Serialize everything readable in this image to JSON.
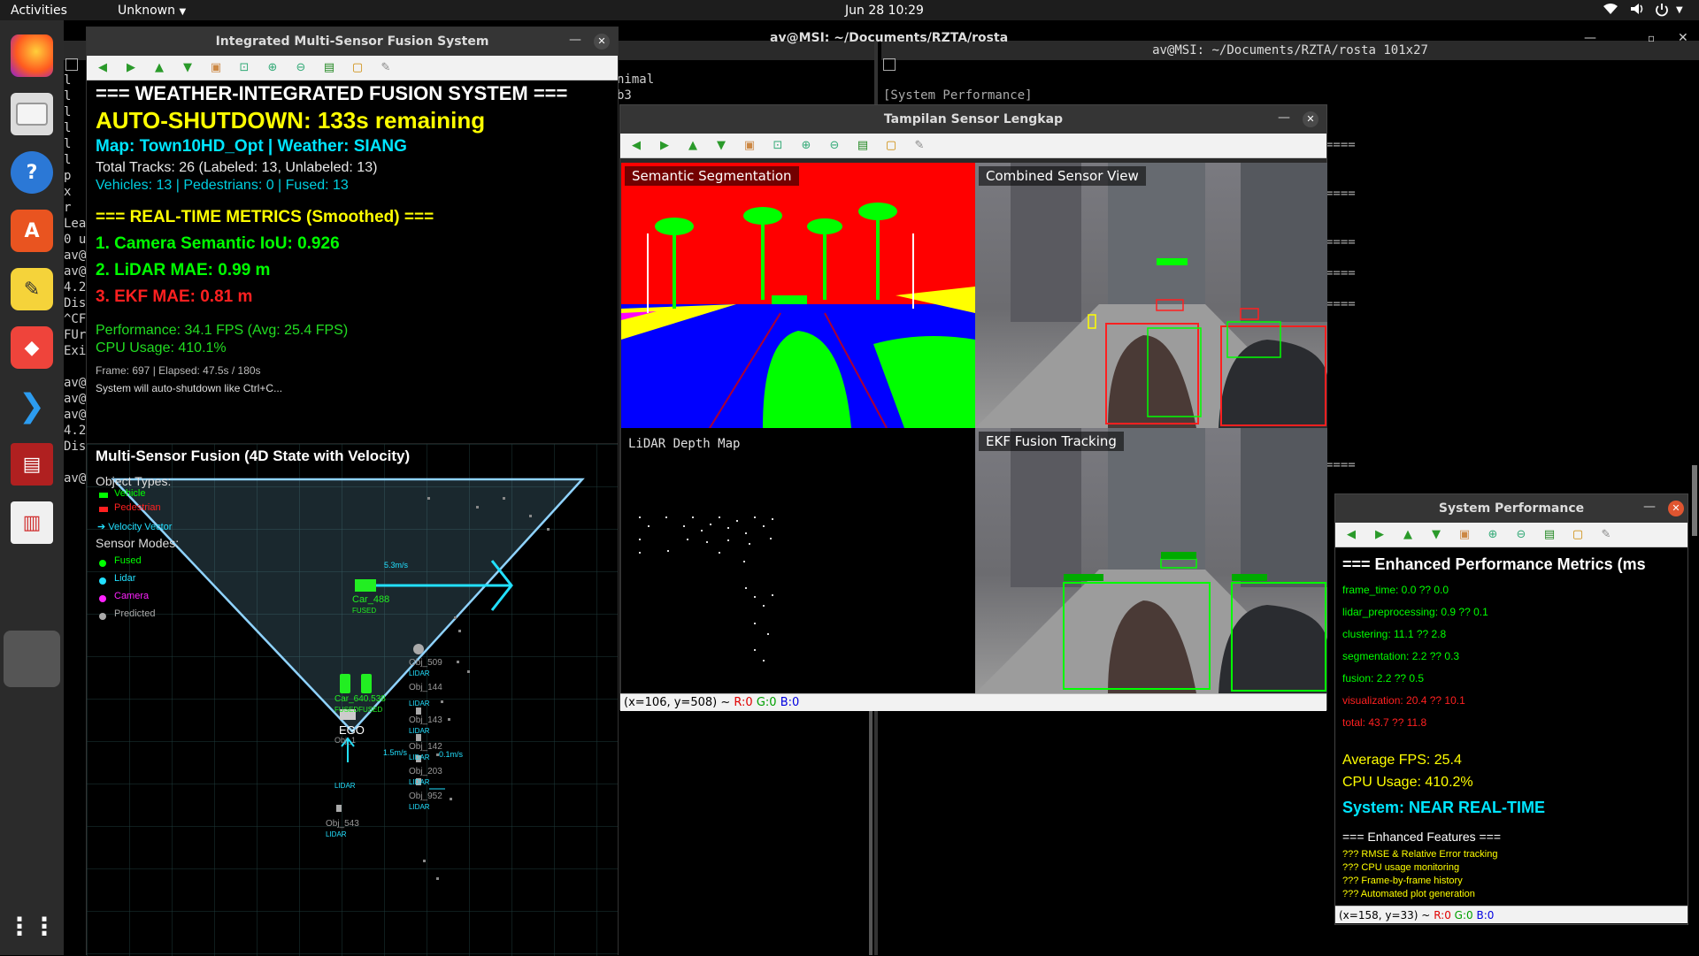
{
  "topbar": {
    "activities": "Activities",
    "app_menu": "Unknown",
    "clock": "Jun 28  10:29"
  },
  "dock": {
    "icons": [
      "firefox-icon",
      "files-icon",
      "help-icon",
      "app-center-icon",
      "text-editor-icon",
      "anydesk-icon",
      "vscode-icon",
      "system-monitor-icon",
      "document-viewer-icon",
      "show-apps-icon"
    ]
  },
  "terminal_left": {
    "title": "av@MSI: ~/Documents/RZTA/rosta",
    "lines": [
      "l",
      "l",
      "l",
      "l",
      "l",
      "l",
      "p",
      "x",
      "r",
      "Lea",
      "0 u",
      "av@",
      "av@",
      "4.2",
      "Dis",
      "^CF",
      "FUr",
      "Exi",
      "",
      "av@",
      "av@",
      "av@",
      "4.2",
      "Dis",
      "",
      "av@"
    ],
    "snippet1": "nimal",
    "snippet2": "b3"
  },
  "terminal_right": {
    "title": "av@MSI: ~/Documents/RZTA/rosta 101x27",
    "line1": "[System Performance]",
    "dashes": [
      "====",
      "====",
      "====",
      "====",
      "====",
      "===="
    ]
  },
  "fusion_window": {
    "title": "Integrated Multi-Sensor Fusion System",
    "header": "=== WEATHER-INTEGRATED FUSION SYSTEM ===",
    "auto_shutdown": "AUTO-SHUTDOWN: 133s remaining",
    "map_weather": "Map: Town10HD_Opt | Weather: SIANG",
    "total_tracks": "Total Tracks: 26 (Labeled: 13, Unlabeled: 13)",
    "counts": "Vehicles: 13 | Pedestrians: 0 | Fused: 13",
    "metrics_header": "=== REAL-TIME METRICS (Smoothed) ===",
    "metric1": "1. Camera Semantic IoU: 0.926",
    "metric2": "2. LiDAR MAE: 0.99 m",
    "metric3": "3. EKF MAE: 0.81 m",
    "performance": "Performance: 34.1 FPS (Avg: 25.4 FPS)",
    "cpu": "CPU Usage: 410.1%",
    "frame": "Frame: 697 | Elapsed: 47.5s / 180s",
    "shutdown_note": "System will auto-shutdown like Ctrl+C...",
    "bev_title": "Multi-Sensor Fusion (4D State with Velocity)",
    "object_types": "Object Types:",
    "legend_vehicle": "Vehicle",
    "legend_pedestrian": "Pedestrian",
    "legend_velocity": "Velocity Vector",
    "sensor_modes": "Sensor Modes:",
    "mode_fused": "Fused",
    "mode_lidar": "Lidar",
    "mode_camera": "Camera",
    "mode_predicted": "Predicted",
    "car_label": "Car_488",
    "car_tag": "FUSED",
    "car_speed": "5.3m/s",
    "ego": "EGO",
    "ego_speed": "1.5m/s",
    "near_label": "Car_640.538",
    "near_tag": "FUSEDFUSED",
    "objects": [
      {
        "name": "Obj_509",
        "tag": "LIDAR"
      },
      {
        "name": "Obj_144",
        "tag": "LIDAR"
      },
      {
        "name": "Obj_143",
        "tag": "LIDAR"
      },
      {
        "name": "Obj_142",
        "tag": "LIDAR"
      },
      {
        "name": "Obj_203",
        "tag": "LIDAR"
      },
      {
        "name": "Obj_952",
        "tag": "LIDAR"
      },
      {
        "name": "Obj_543",
        "tag": "LIDAR"
      },
      {
        "name": "Obj_1",
        "tag": "LIDAR"
      }
    ],
    "obj142_speed": "0.1m/s"
  },
  "sensor_window": {
    "title": "Tampilan Sensor Lengkap",
    "panel1": "Semantic Segmentation",
    "panel2": "Combined Sensor View",
    "panel3": "LiDAR Depth Map",
    "panel4": "EKF Fusion Tracking",
    "status": "(x=106, y=508) ~",
    "r": "R:0",
    "g": "G:0",
    "b": "B:0"
  },
  "perf_window": {
    "title": "System Performance",
    "header": "=== Enhanced Performance Metrics (ms",
    "frame_time": "frame_time: 0.0 ?? 0.0",
    "lidar_pre": "lidar_preprocessing: 0.9 ?? 0.1",
    "clustering": "clustering: 11.1 ?? 2.8",
    "segmentation": "segmentation: 2.2 ?? 0.3",
    "fusion": "fusion: 2.2 ?? 0.5",
    "visualization": "visualization: 20.4 ?? 10.1",
    "total": "total: 43.7 ?? 11.8",
    "avg_fps": "Average FPS: 25.4",
    "cpu": "CPU Usage: 410.2%",
    "system": "System: NEAR REAL-TIME",
    "features_header": "=== Enhanced Features ===",
    "f1": "??? RMSE & Relative Error tracking",
    "f2": "??? CPU usage monitoring",
    "f3": "??? Frame-by-frame history",
    "f4": "??? Automated plot generation",
    "status": "(x=158, y=33) ~",
    "r": "R:0",
    "g": "G:0",
    "b": "B:0"
  },
  "colors": {
    "yellow": "#ffff00",
    "cyan": "#00e5ff",
    "green": "#00ff00",
    "red": "#ff2020",
    "seg_sky": "#ff0000",
    "seg_road": "#0000ff",
    "seg_vehicle": "#00ff00"
  }
}
